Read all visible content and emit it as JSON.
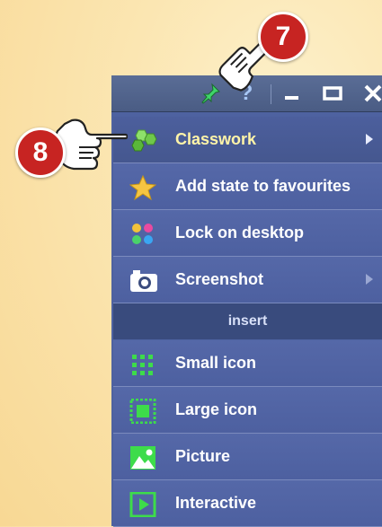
{
  "callouts": [
    {
      "number": "7",
      "target": "pin-icon"
    },
    {
      "number": "8",
      "target": "classwork-item"
    }
  ],
  "titlebar": {
    "help_glyph": "?",
    "buttons": [
      "pin-icon",
      "help-icon",
      "minimize-icon",
      "maximize-icon",
      "close-icon"
    ]
  },
  "menu": {
    "items": [
      {
        "label": "Classwork",
        "icon": "classwork-icon",
        "submenu": true
      },
      {
        "label": "Add state to favourites",
        "icon": "star-icon",
        "submenu": false
      },
      {
        "label": "Lock on desktop",
        "icon": "lock-desktop-icon",
        "submenu": false
      },
      {
        "label": "Screenshot",
        "icon": "camera-icon",
        "submenu": true
      }
    ],
    "section": "insert",
    "insert_items": [
      {
        "label": "Small icon",
        "icon": "small-icon-dots"
      },
      {
        "label": "Large icon",
        "icon": "large-icon-square"
      },
      {
        "label": "Picture",
        "icon": "picture-icon"
      },
      {
        "label": "Interactive",
        "icon": "interactive-play-icon"
      }
    ]
  },
  "colors": {
    "menu_bg": "#4e62a0",
    "active_label": "#fff4a8",
    "badge_red": "#c72422",
    "icon_green": "#3ddc4a"
  }
}
